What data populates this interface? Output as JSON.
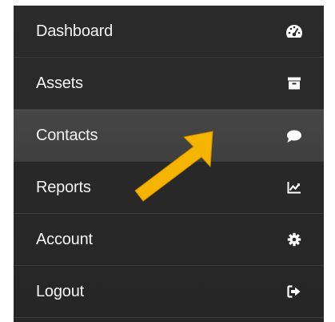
{
  "menu": {
    "items": [
      {
        "label": "Dashboard",
        "icon": "dashboard-gauge-icon"
      },
      {
        "label": "Assets",
        "icon": "archive-box-icon"
      },
      {
        "label": "Contacts",
        "icon": "chat-bubble-icon",
        "active": true
      },
      {
        "label": "Reports",
        "icon": "line-chart-icon"
      },
      {
        "label": "Account",
        "icon": "gear-icon"
      },
      {
        "label": "Logout",
        "icon": "sign-out-icon"
      }
    ]
  },
  "colors": {
    "menu_background": "#2a2a2a",
    "active_background": "#444444",
    "text": "#f4f4f4",
    "annotation_arrow": "#f5b400"
  }
}
